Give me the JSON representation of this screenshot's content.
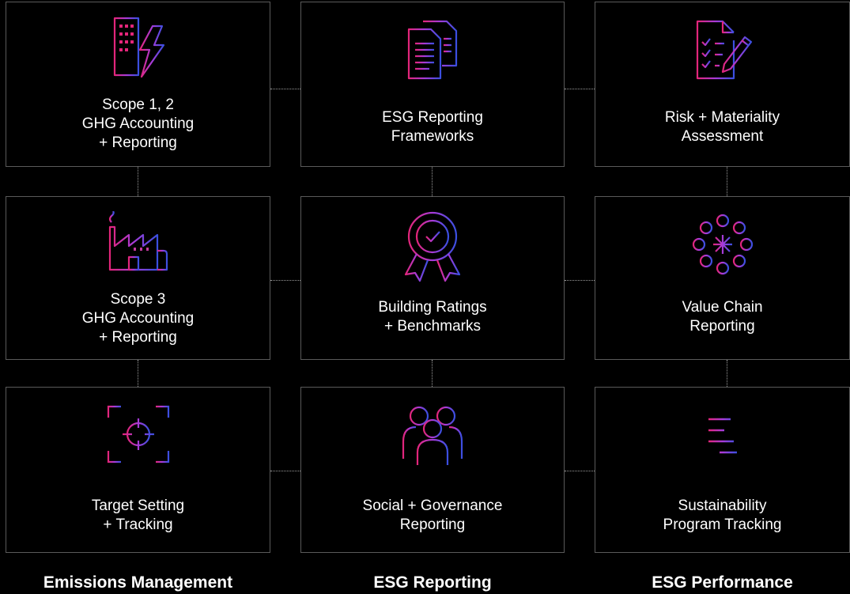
{
  "colors": {
    "gradient_start": "#e3257a",
    "gradient_mid": "#a63bd8",
    "gradient_end": "#3a4fe0",
    "card_border": "#5a5a5a",
    "connector": "#9a9a9a"
  },
  "columns": [
    {
      "title": "Emissions Management",
      "cards": [
        {
          "icon": "building-lightning-icon",
          "lines": [
            "Scope 1, 2",
            "GHG Accounting",
            "+ Reporting"
          ]
        },
        {
          "icon": "factory-icon",
          "lines": [
            "Scope 3",
            "GHG Accounting",
            "+ Reporting"
          ]
        },
        {
          "icon": "target-crosshair-icon",
          "lines": [
            "Target Setting",
            "+ Tracking"
          ]
        }
      ]
    },
    {
      "title": "ESG Reporting",
      "cards": [
        {
          "icon": "documents-icon",
          "lines": [
            "ESG Reporting",
            "Frameworks"
          ]
        },
        {
          "icon": "award-ribbon-icon",
          "lines": [
            "Building Ratings",
            "+ Benchmarks"
          ]
        },
        {
          "icon": "people-group-icon",
          "lines": [
            "Social + Governance",
            "Reporting"
          ]
        }
      ]
    },
    {
      "title": "ESG Performance",
      "cards": [
        {
          "icon": "checklist-pen-icon",
          "lines": [
            "Risk + Materiality",
            "Assessment"
          ]
        },
        {
          "icon": "value-chain-network-icon",
          "lines": [
            "Value Chain",
            "Reporting"
          ]
        },
        {
          "icon": "program-tracking-icon",
          "lines": [
            "Sustainability",
            "Program Tracking"
          ]
        }
      ]
    }
  ]
}
